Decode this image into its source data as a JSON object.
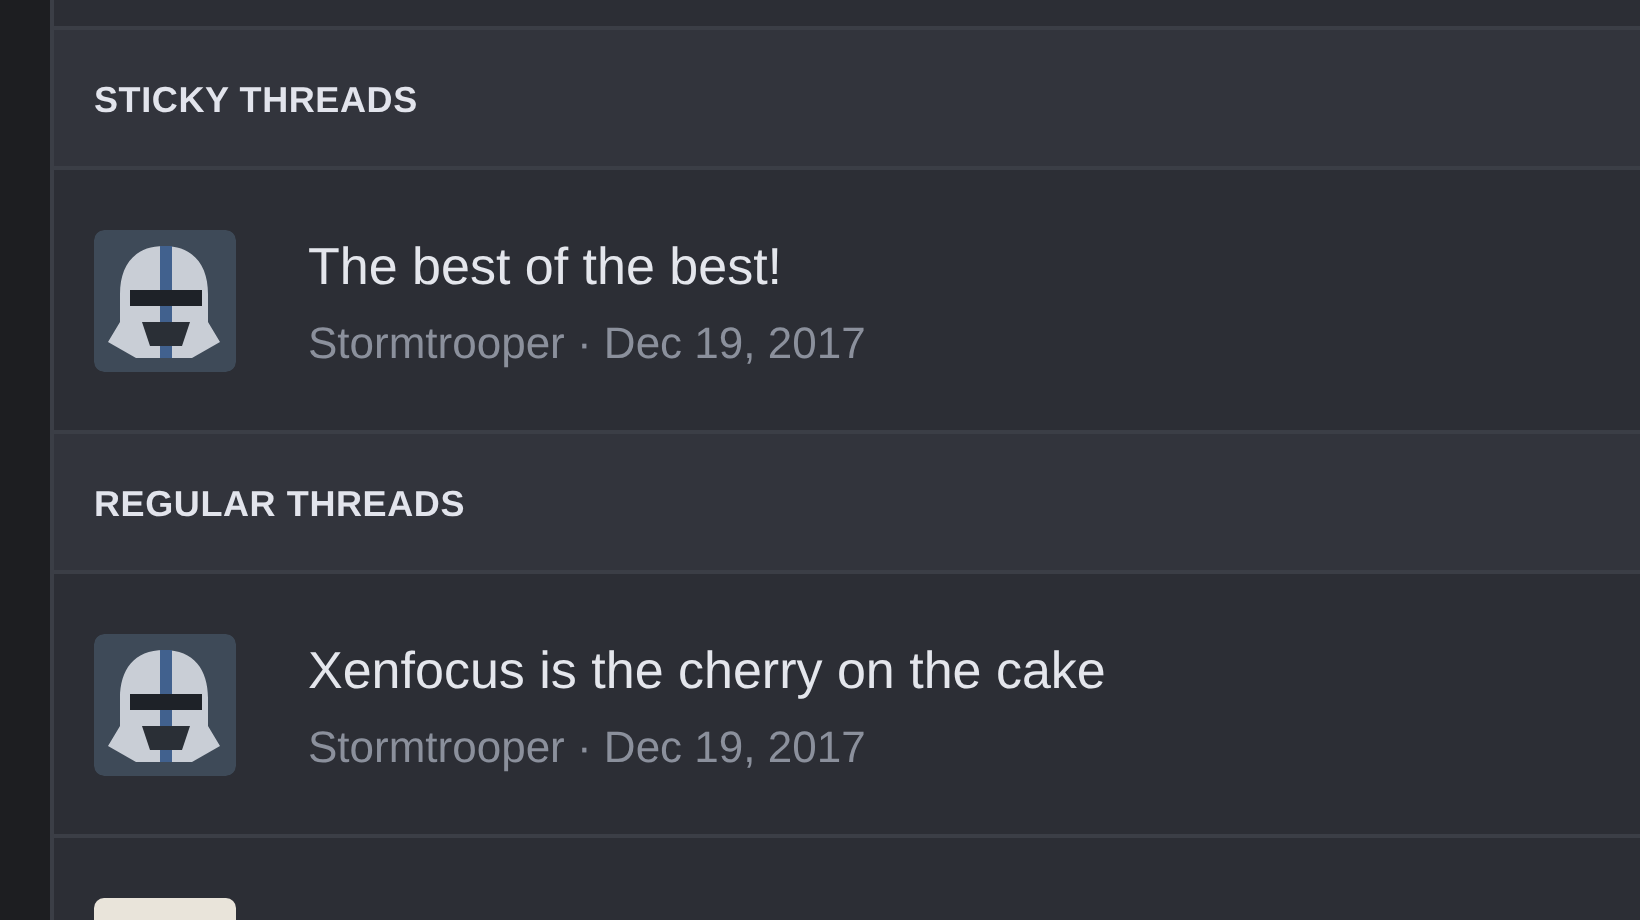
{
  "sections": [
    {
      "title": "STICKY THREADS",
      "threads": [
        {
          "kind": "helmet",
          "title": "The best of the best!",
          "meta": "Stormtrooper · Dec 19, 2017"
        }
      ]
    },
    {
      "title": "REGULAR THREADS",
      "threads": [
        {
          "kind": "helmet",
          "title": "Xenfocus is the cherry on the cake",
          "meta": "Stormtrooper · Dec 19, 2017"
        },
        {
          "kind": "photo"
        }
      ]
    }
  ]
}
